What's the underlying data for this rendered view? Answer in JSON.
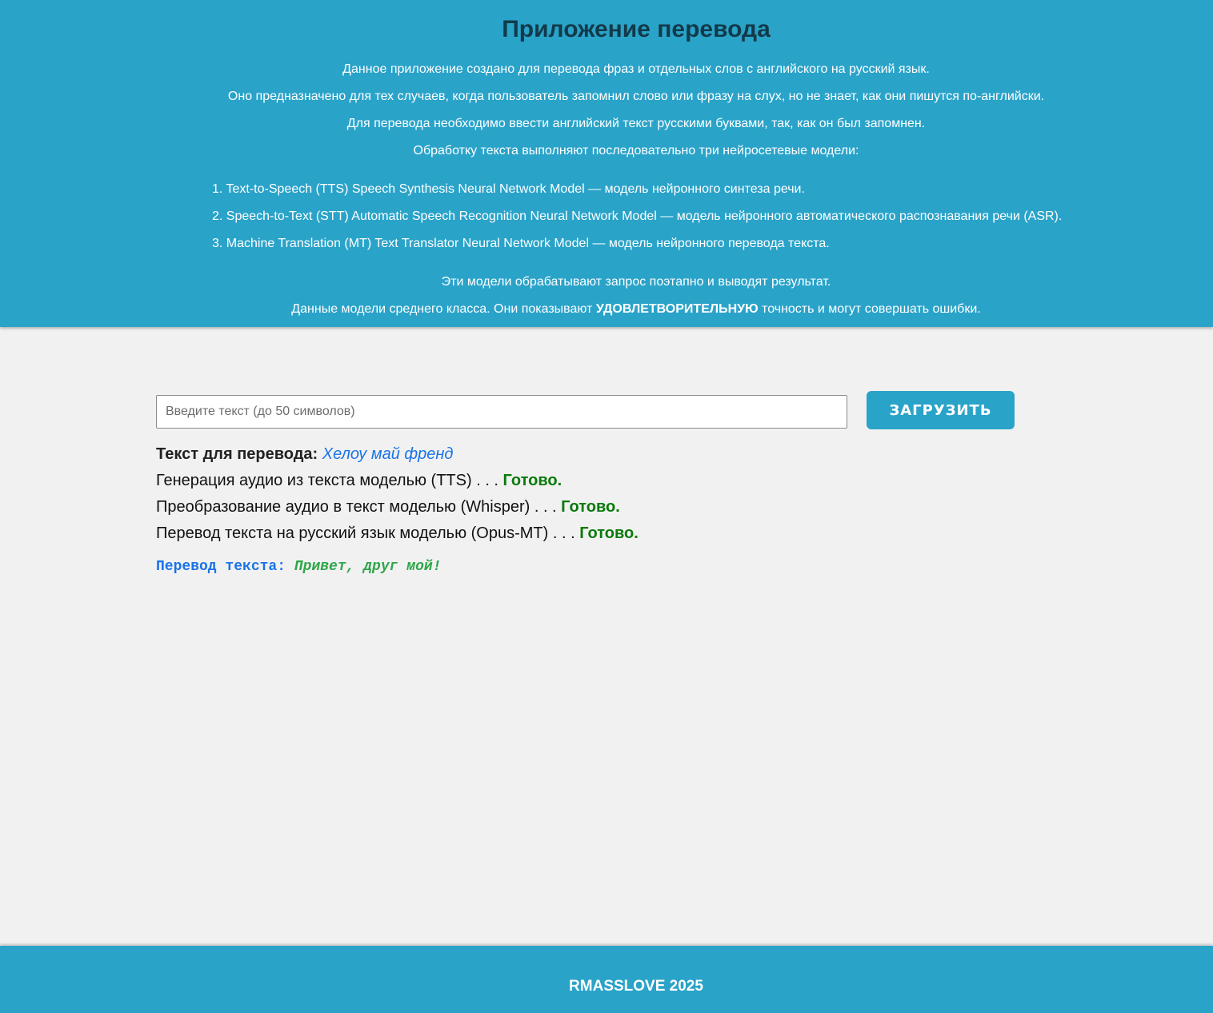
{
  "header": {
    "title": "Приложение перевода",
    "intro": [
      "Данное приложение создано для перевода фраз и отдельных слов с английского на русский язык.",
      "Оно предназначено для тех случаев, когда пользователь запомнил слово или фразу на слух, но не знает, как они пишутся по-английски.",
      "Для перевода необходимо ввести английский текст русскими буквами, так, как он был запомнен.",
      "Обработку текста выполняют последовательно три нейросетевые модели:"
    ],
    "models": [
      "1. Text-to-Speech (TTS) Speech Synthesis Neural Network Model — модель нейронного синтеза речи.",
      "2. Speech-to-Text (STT) Automatic Speech Recognition Neural Network Model — модель нейронного автоматического распознавания речи (ASR).",
      "3. Machine Translation (MT) Text Translator Neural Network Model — модель нейронного перевода текста."
    ],
    "outro": "Эти модели обрабатывают запрос поэтапно и выводят результат.",
    "note_prefix": "Данные модели среднего класса. Они показывают ",
    "note_emphasis": "УДОВЛЕТВОРИТЕЛЬНУЮ",
    "note_suffix": " точность и могут совершать ошибки."
  },
  "form": {
    "input_value": "",
    "input_placeholder": "Введите текст (до 50 символов)",
    "upload_label": "ЗАГРУЗИТЬ"
  },
  "status": {
    "source_label": "Текст для перевода:",
    "source_value": "Хелоу май френд",
    "steps": [
      {
        "text": "Генерация аудио из текста моделью (TTS) . . . ",
        "result": "Готово."
      },
      {
        "text": "Преобразование аудио в текст моделью (Whisper) . . . ",
        "result": "Готово."
      },
      {
        "text": "Перевод текста на русский язык моделью (Opus-MT) . . . ",
        "result": "Готово."
      }
    ],
    "translation_label": "Перевод текста:",
    "translation_value": "Привет, друг мой!"
  },
  "footer": {
    "text": "RMASSLOVE 2025"
  },
  "colors": {
    "header_bg": "#2aa3c9",
    "title": "#123a4a",
    "page_bg": "#f1f1f1",
    "done": "#0a7a0a",
    "source_value": "#1a73e8",
    "translation_value": "#2fa64a"
  }
}
